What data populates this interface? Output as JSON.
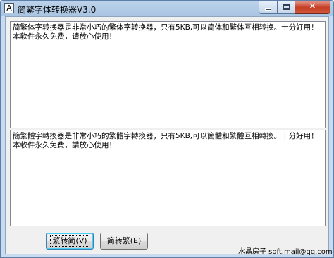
{
  "window": {
    "title": "简繁字体转换器V3.0",
    "app_icon_glyph": "A",
    "close_glyph": "✕"
  },
  "text_areas": {
    "simplified": "简繁体字转换器是非常小巧的繁体字转换器，只有5KB,可以简体和繁体互相转换。十分好用！本软件永久免费，请放心使用！",
    "traditional": "簡繁體字轉換器是非常小巧的繁體字轉換器，只有5KB,可以簡體和繁體互相轉換。十分好用！本軟件永久免費，請放心使用！"
  },
  "buttons": {
    "to_simplified": "繁转简(V)",
    "to_traditional": "简转繁(E)"
  },
  "footer": {
    "credit": "水晶房子 soft.mail@qq.com"
  },
  "colors": {
    "title_bar": "#a9c4e2",
    "close_button": "#c43c22",
    "client_bg": "#f0f0f0"
  }
}
